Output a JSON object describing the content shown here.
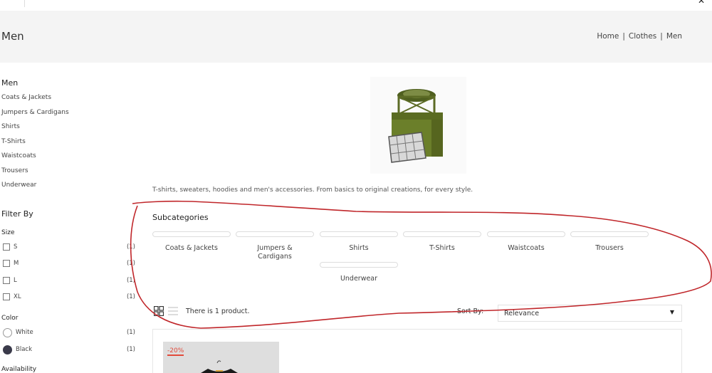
{
  "header": {
    "title": "Men",
    "breadcrumbs": [
      "Home",
      "Clothes",
      "Men"
    ],
    "breadcrumb_divider": "|"
  },
  "sidebar": {
    "heading": "Men",
    "categories": [
      "Coats & Jackets",
      "Jumpers & Cardigans",
      "Shirts",
      "T-Shirts",
      "Waistcoats",
      "Trousers",
      "Underwear"
    ],
    "filter_title": "Filter By",
    "size": {
      "title": "Size",
      "options": [
        {
          "label": "S",
          "count": "(1)"
        },
        {
          "label": "M",
          "count": "(1)"
        },
        {
          "label": "L",
          "count": "(1)"
        },
        {
          "label": "XL",
          "count": "(1)"
        }
      ]
    },
    "color": {
      "title": "Color",
      "options": [
        {
          "label": "White",
          "count": "(1)",
          "swatch": "#ffffff"
        },
        {
          "label": "Black",
          "count": "(1)",
          "swatch": "#3a3a4a"
        }
      ]
    },
    "availability_title": "Availability"
  },
  "main": {
    "description": "T-shirts, sweaters, hoodies and men's accessories. From basics to original creations, for every style.",
    "subcategories_title": "Subcategories",
    "subcategories": [
      "Coats & Jackets",
      "Jumpers & Cardigans",
      "Shirts",
      "T-Shirts",
      "Waistcoats",
      "Trousers",
      "Underwear"
    ],
    "product_count_text": "There is 1 product.",
    "sort_label": "Sort By:",
    "sort_value": "Relevance",
    "product": {
      "discount_badge": "-20%"
    }
  },
  "icons": {
    "grid": "grid-view-icon",
    "list": "list-view-icon",
    "close": "close-icon",
    "caret": "caret-down-icon"
  },
  "colors": {
    "banner_bg": "#f4f4f4",
    "discount": "#e24a3b",
    "annotation_stroke": "#c0262a",
    "hero_green": "#6b7f2a"
  }
}
